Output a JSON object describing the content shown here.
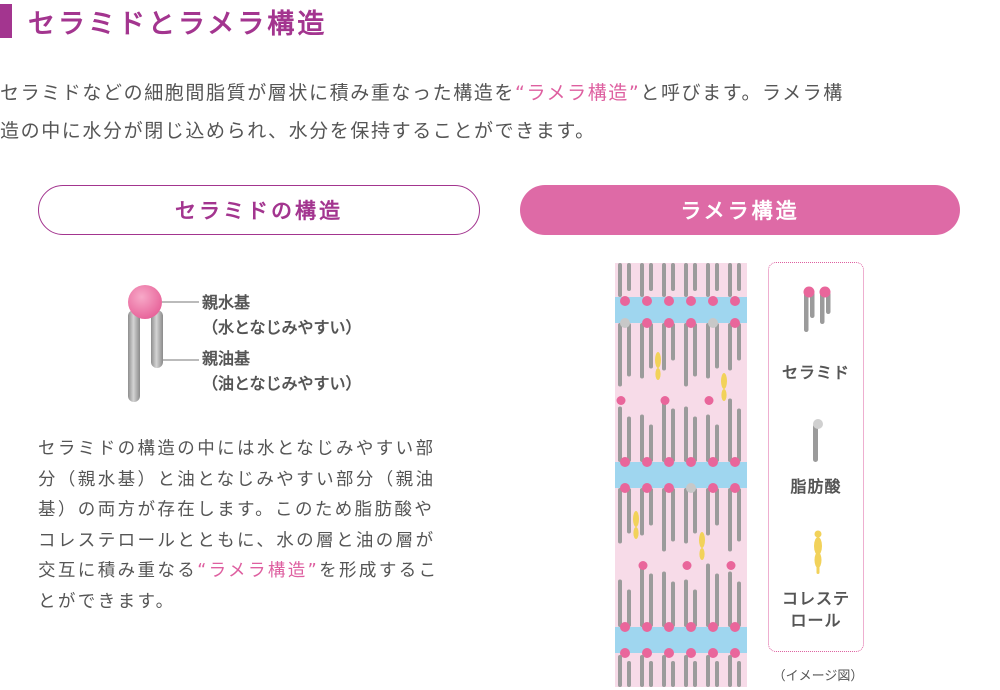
{
  "title": "セラミドとラメラ構造",
  "intro": {
    "line1_before": "セラミドなどの細胞間脂質が層状に積み重なった構造を",
    "line1_highlight": "“ラメラ構造”",
    "line1_after": "と呼びます。ラメラ構",
    "line2": "造の中に水分が閉じ込められ、水分を保持することができます。"
  },
  "left_pill": "セラミドの構造",
  "right_pill": "ラメラ構造",
  "molecule": {
    "head_label_1": "親水基",
    "head_label_2": "（水となじみやすい）",
    "tail_label_1": "親油基",
    "tail_label_2": "（油となじみやすい）"
  },
  "description": {
    "line1": "セラミドの構造の中には水となじみやすい部",
    "line2": "分（親水基）と油となじみやすい部分（親油",
    "line3": "基）の両方が存在します。このため脂肪酸や",
    "line4": "コレステロールとともに、水の層と油の層が",
    "line5_before": "交互に積み重なる",
    "line5_highlight": "“ラメラ構造”",
    "line5_after": "を形成するこ",
    "line6": "とができます。"
  },
  "legend": {
    "ceramide": "セラミド",
    "fatty_acid": "脂肪酸",
    "cholesterol_1": "コレステ",
    "cholesterol_2": "ロール"
  },
  "caption": "（イメージ図）",
  "colors": {
    "title": "#a3358f",
    "accent_pink": "#de5fa0",
    "pill_fill": "#de6aa6",
    "water_layer": "#9fd6ef",
    "diagram_bg": "#f7dbe8",
    "ceramide_head": "#e9669b",
    "fatty_acid_head": "#c8c8c8",
    "cholesterol": "#f2d25a",
    "tail_gray": "#9b9b9b"
  }
}
